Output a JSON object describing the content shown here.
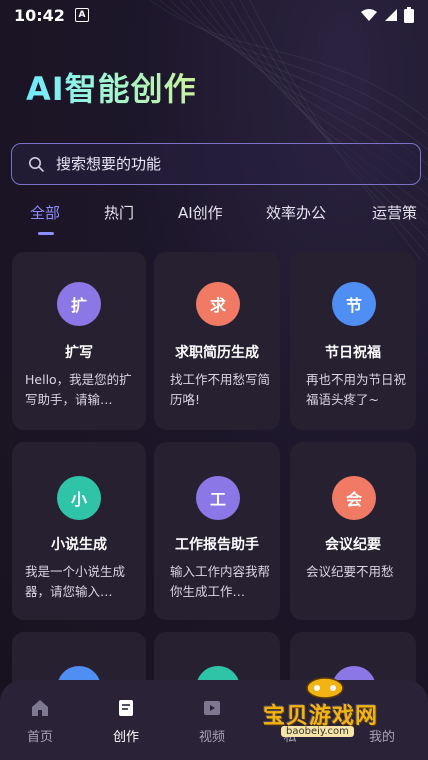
{
  "status_bar": {
    "time": "10:42",
    "app_icon_letter": "A"
  },
  "header": {
    "title": "AI智能创作"
  },
  "search": {
    "placeholder": "搜索想要的功能"
  },
  "tabs": [
    {
      "label": "全部",
      "active": true
    },
    {
      "label": "热门",
      "active": false
    },
    {
      "label": "AI创作",
      "active": false
    },
    {
      "label": "效率办公",
      "active": false
    },
    {
      "label": "运营策",
      "active": false
    }
  ],
  "cards": [
    {
      "badge": "扩",
      "badge_color": "#8b78e6",
      "title": "扩写",
      "desc": "Hello，我是您的扩写助手，请输…"
    },
    {
      "badge": "求",
      "badge_color": "#f07a63",
      "title": "求职简历生成",
      "desc": "找工作不用愁写简历咯!"
    },
    {
      "badge": "节",
      "badge_color": "#4f8ef2",
      "title": "节日祝福",
      "desc": "再也不用为节日祝福语头疼了~"
    },
    {
      "badge": "小",
      "badge_color": "#2fc4a8",
      "title": "小说生成",
      "desc": "我是一个小说生成器，请您输入…"
    },
    {
      "badge": "工",
      "badge_color": "#8b78e6",
      "title": "工作报告助手",
      "desc": "输入工作内容我帮你生成工作…"
    },
    {
      "badge": "会",
      "badge_color": "#f07a63",
      "title": "会议纪要",
      "desc": "会议纪要不用愁"
    }
  ],
  "bottom_nav": [
    {
      "label": "首页",
      "icon": "home-icon",
      "active": false
    },
    {
      "label": "创作",
      "icon": "create-icon",
      "active": true
    },
    {
      "label": "视频",
      "icon": "video-icon",
      "active": false
    },
    {
      "label": "私",
      "icon": "message-icon",
      "active": false
    },
    {
      "label": "我的",
      "icon": "profile-icon",
      "active": false
    }
  ],
  "watermark": {
    "text": "宝贝游戏网",
    "url": "baobeiy.com"
  }
}
